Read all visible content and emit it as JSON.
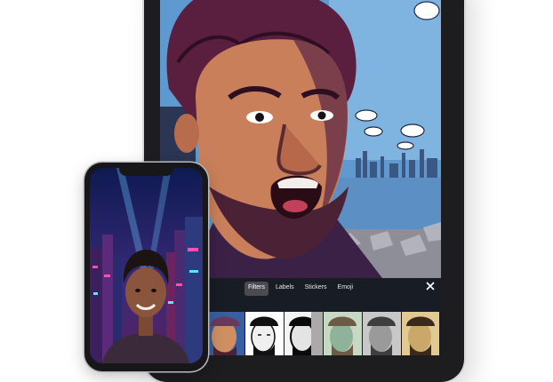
{
  "toolbar": {
    "tabs": [
      {
        "label": "Filters",
        "active": true
      },
      {
        "label": "Labels",
        "active": false
      },
      {
        "label": "Stickers",
        "active": false
      },
      {
        "label": "Emoji",
        "active": false
      }
    ],
    "close_icon": "close-icon"
  },
  "filter_thumbnails": [
    {
      "style": "comic-color",
      "colors": [
        "#6b3a5a",
        "#cf8f63",
        "#3a5fa0"
      ]
    },
    {
      "style": "ink-bw",
      "colors": [
        "#ffffff",
        "#111111",
        "#888888"
      ]
    },
    {
      "style": "ink-bw-bold",
      "colors": [
        "#f4f4f4",
        "#0a0a0a",
        "#aaaaaa"
      ]
    },
    {
      "style": "watercolor",
      "colors": [
        "#8fb39a",
        "#6f5a46",
        "#c7d9c2"
      ]
    },
    {
      "style": "mono-gray",
      "colors": [
        "#9a9a9a",
        "#3e3e3e",
        "#c8c8c8"
      ]
    },
    {
      "style": "warm-comic",
      "colors": [
        "#c9a86a",
        "#3b2a1c",
        "#e2c992"
      ]
    }
  ],
  "colors": {
    "ipad_body": "#1d1d1f",
    "toolbar_bg": "#16161a",
    "active_tab": "#4a4a50",
    "sky": "#6ea8d8",
    "hair": "#5a1f3e",
    "skin": "#c9805a"
  }
}
